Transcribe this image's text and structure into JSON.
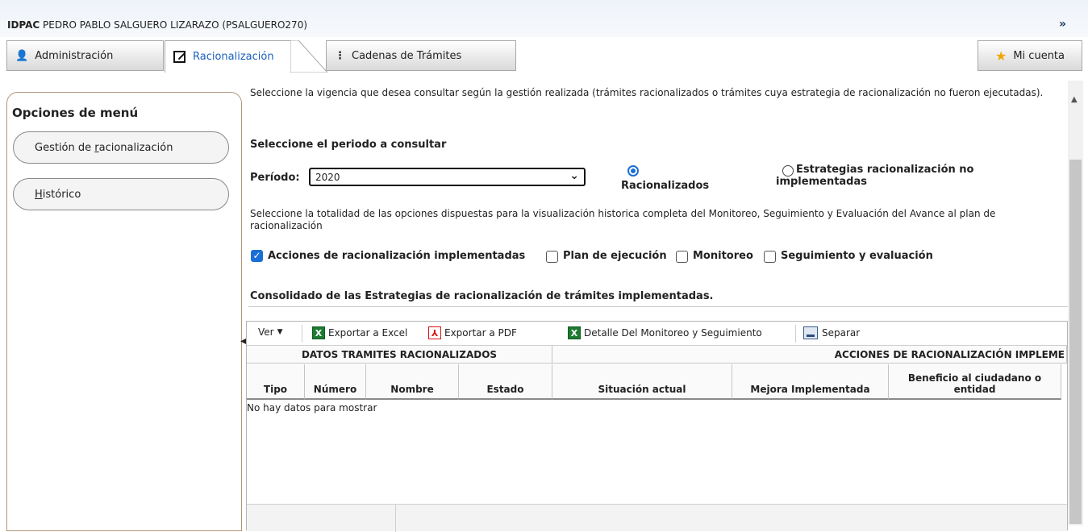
{
  "header": {
    "org": "IDPAC",
    "user": "PEDRO PABLO SALGUERO LIZARAZO (PSALGUERO270)",
    "expand_icon": "»"
  },
  "tabs": [
    {
      "label": "Administración",
      "icon": "user-admin-icon"
    },
    {
      "label": "Racionalización",
      "icon": "edit-icon"
    },
    {
      "label": "Cadenas de Trámites",
      "icon": "flow-icon"
    },
    {
      "label": "Mi cuenta",
      "icon": "star-icon"
    }
  ],
  "sidebar": {
    "title": "Opciones de menú",
    "items": [
      {
        "label_prefix": "Gestión de ",
        "label_accel": "r",
        "label_rest": "acionalización"
      },
      {
        "label_prefix": "",
        "label_accel": "H",
        "label_rest": "istórico"
      }
    ]
  },
  "main": {
    "intro": "Seleccione la vigencia que desea consultar según la gestión realizada (trámites racionalizados o trámites cuya estrategia de racionalización no fueron ejecutadas).",
    "section_title": "Seleccione el periodo a consultar",
    "period_label": "Período:",
    "period_value": "2020",
    "radios": [
      {
        "label": "Racionalizados",
        "checked": true
      },
      {
        "label": "Estrategias racionalización no implementadas",
        "checked": false
      }
    ],
    "options_text": "Seleccione la totalidad de las opciones dispuestas para la visualización historica completa del Monitoreo, Seguimiento y Evaluación del Avance al plan de racionalización",
    "checkboxes": [
      {
        "label": "Acciones de racionalización implementadas",
        "checked": true
      },
      {
        "label": "Plan de ejecución",
        "checked": false
      },
      {
        "label": "Monitoreo",
        "checked": false
      },
      {
        "label": "Seguimiento y evaluación",
        "checked": false
      }
    ],
    "consolidated_title": "Consolidado de las Estrategias de racionalización de trámites implementadas."
  },
  "grid": {
    "toolbar": {
      "view": "Ver",
      "export_excel": "Exportar a Excel",
      "export_pdf": "Exportar a PDF",
      "detail": "Detalle Del Monitoreo y Seguimiento",
      "separate": "Separar"
    },
    "groups": [
      "DATOS TRAMITES RACIONALIZADOS",
      "ACCIONES DE RACIONALIZACIÓN IMPLEME"
    ],
    "columns": [
      "Tipo",
      "Número",
      "Nombre",
      "Estado",
      "Situación actual",
      "Mejora Implementada",
      "Beneficio al ciudadano o entidad"
    ],
    "empty_text": "No hay datos para mostrar"
  },
  "colors": {
    "accent_blue": "#1a6fd6",
    "tab_active_text": "#1a5fbf",
    "sidebar_border": "#b0957c"
  }
}
